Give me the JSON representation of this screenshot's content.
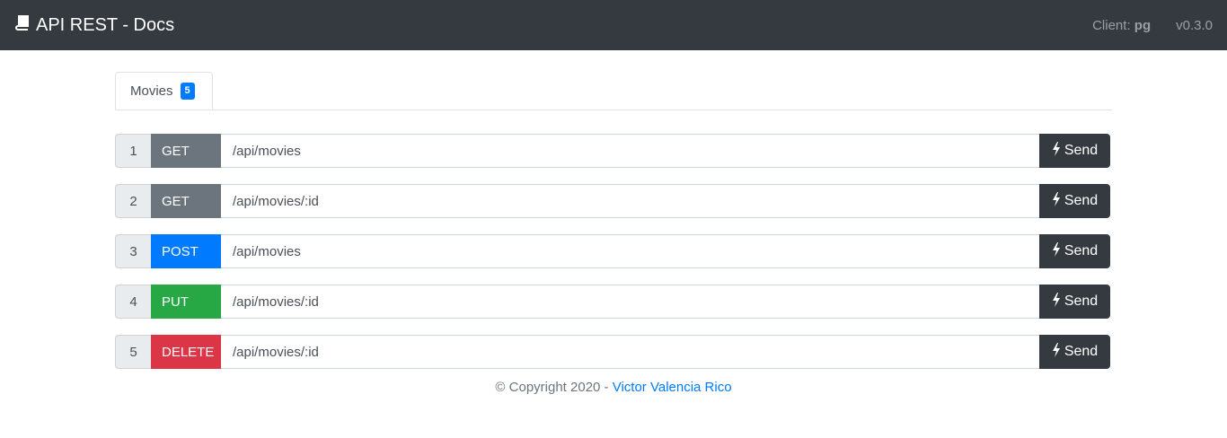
{
  "header": {
    "title": "API REST - Docs",
    "client_label": "Client:",
    "client_value": "pg",
    "version": "v0.3.0"
  },
  "tabs": [
    {
      "label": "Movies",
      "badge": "5"
    }
  ],
  "endpoints": [
    {
      "index": "1",
      "method": "GET",
      "path": "/api/movies",
      "method_color": "#6c757d",
      "send_label": "Send"
    },
    {
      "index": "2",
      "method": "GET",
      "path": "/api/movies/:id",
      "method_color": "#6c757d",
      "send_label": "Send"
    },
    {
      "index": "3",
      "method": "POST",
      "path": "/api/movies",
      "method_color": "#007bff",
      "send_label": "Send"
    },
    {
      "index": "4",
      "method": "PUT",
      "path": "/api/movies/:id",
      "method_color": "#28a745",
      "send_label": "Send"
    },
    {
      "index": "5",
      "method": "DELETE",
      "path": "/api/movies/:id",
      "method_color": "#dc3545",
      "send_label": "Send"
    }
  ],
  "footer": {
    "copyright": "© Copyright 2020 -",
    "author": "Victor Valencia Rico"
  },
  "icons": {
    "brand": "book-icon",
    "send": "bolt-icon"
  }
}
